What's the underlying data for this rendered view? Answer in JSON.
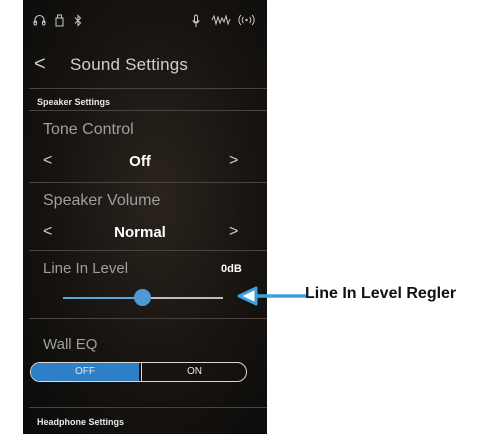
{
  "status_bar": {
    "icons": [
      "headphones-icon",
      "usb-icon",
      "bluetooth-icon",
      "microphone-icon",
      "audio-waveform-icon",
      "wireless-icon"
    ]
  },
  "header": {
    "back_symbol": "<",
    "title": "Sound Settings"
  },
  "sections": {
    "speaker_settings": "Speaker Settings",
    "headphone_settings": "Headphone Settings"
  },
  "tone_control": {
    "title": "Tone Control",
    "value": "Off",
    "prev": "<",
    "next": ">"
  },
  "speaker_volume": {
    "title": "Speaker Volume",
    "value": "Normal",
    "prev": "<",
    "next": ">"
  },
  "line_in_level": {
    "title": "Line In Level",
    "value": "0dB",
    "slider_fraction": 0.5
  },
  "wall_eq": {
    "title": "Wall EQ",
    "off_label": "OFF",
    "on_label": "ON",
    "selected": "OFF"
  },
  "callout": {
    "label": "Line In Level Regler"
  },
  "colors": {
    "accent": "#2f7fc7",
    "arrow": "#3aa0dd",
    "background": "#141210"
  }
}
